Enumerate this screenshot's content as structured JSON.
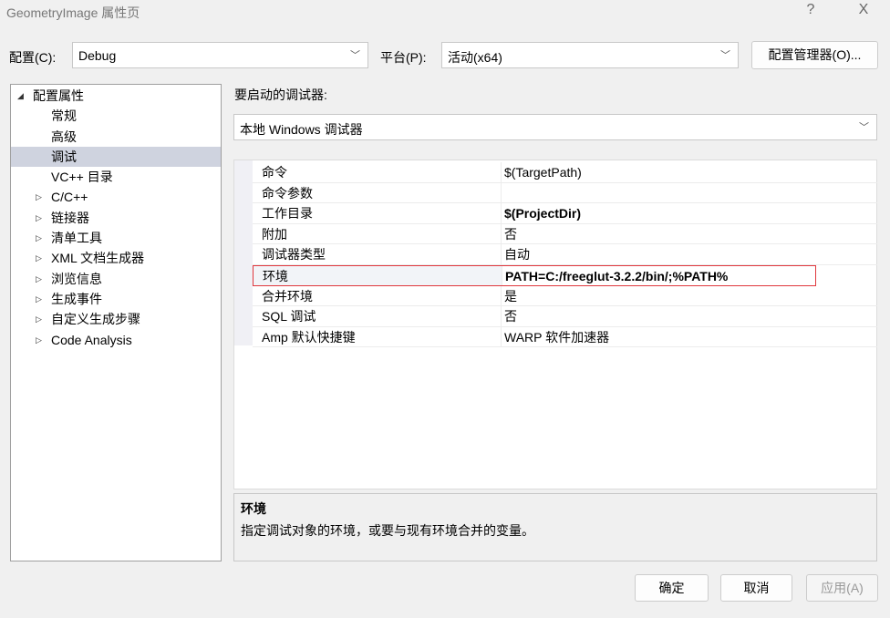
{
  "window": {
    "title": "GeometryImage 属性页",
    "help": "?",
    "close": "X"
  },
  "toolbar": {
    "config_label": "配置(C):",
    "config_value": "Debug",
    "platform_label": "平台(P):",
    "platform_value": "活动(x64)",
    "config_manager": "配置管理器(O)..."
  },
  "tree": {
    "items": [
      {
        "label": "配置属性",
        "arrow": "◢",
        "level": 0
      },
      {
        "label": "常规",
        "arrow": "",
        "level": 1
      },
      {
        "label": "高级",
        "arrow": "",
        "level": 1
      },
      {
        "label": "调试",
        "arrow": "",
        "level": 1,
        "selected": true
      },
      {
        "label": "VC++ 目录",
        "arrow": "",
        "level": 1
      },
      {
        "label": "C/C++",
        "arrow": "▷",
        "level": 1
      },
      {
        "label": "链接器",
        "arrow": "▷",
        "level": 1
      },
      {
        "label": "清单工具",
        "arrow": "▷",
        "level": 1
      },
      {
        "label": "XML 文档生成器",
        "arrow": "▷",
        "level": 1
      },
      {
        "label": "浏览信息",
        "arrow": "▷",
        "level": 1
      },
      {
        "label": "生成事件",
        "arrow": "▷",
        "level": 1
      },
      {
        "label": "自定义生成步骤",
        "arrow": "▷",
        "level": 1
      },
      {
        "label": "Code Analysis",
        "arrow": "▷",
        "level": 1
      }
    ]
  },
  "main": {
    "debugger_label": "要启动的调试器:",
    "debugger_value": "本地 Windows 调试器",
    "properties": [
      {
        "name": "命令",
        "value": "$(TargetPath)"
      },
      {
        "name": "命令参数",
        "value": ""
      },
      {
        "name": "工作目录",
        "value": "$(ProjectDir)",
        "bold": true
      },
      {
        "name": "附加",
        "value": "否"
      },
      {
        "name": "调试器类型",
        "value": "自动"
      },
      {
        "name": "环境",
        "value": "PATH=C:/freeglut-3.2.2/bin/;%PATH%",
        "bold": true,
        "selected": true
      },
      {
        "name": "合并环境",
        "value": "是"
      },
      {
        "name": "SQL 调试",
        "value": "否"
      },
      {
        "name": "Amp 默认快捷键",
        "value": "WARP 软件加速器"
      }
    ],
    "description": {
      "title": "环境",
      "text": "指定调试对象的环境，或要与现有环境合并的变量。"
    }
  },
  "footer": {
    "ok": "确定",
    "cancel": "取消",
    "apply": "应用(A)"
  },
  "colors": {
    "highlight_border": "#e0383e",
    "selection": "#cfd3df"
  }
}
